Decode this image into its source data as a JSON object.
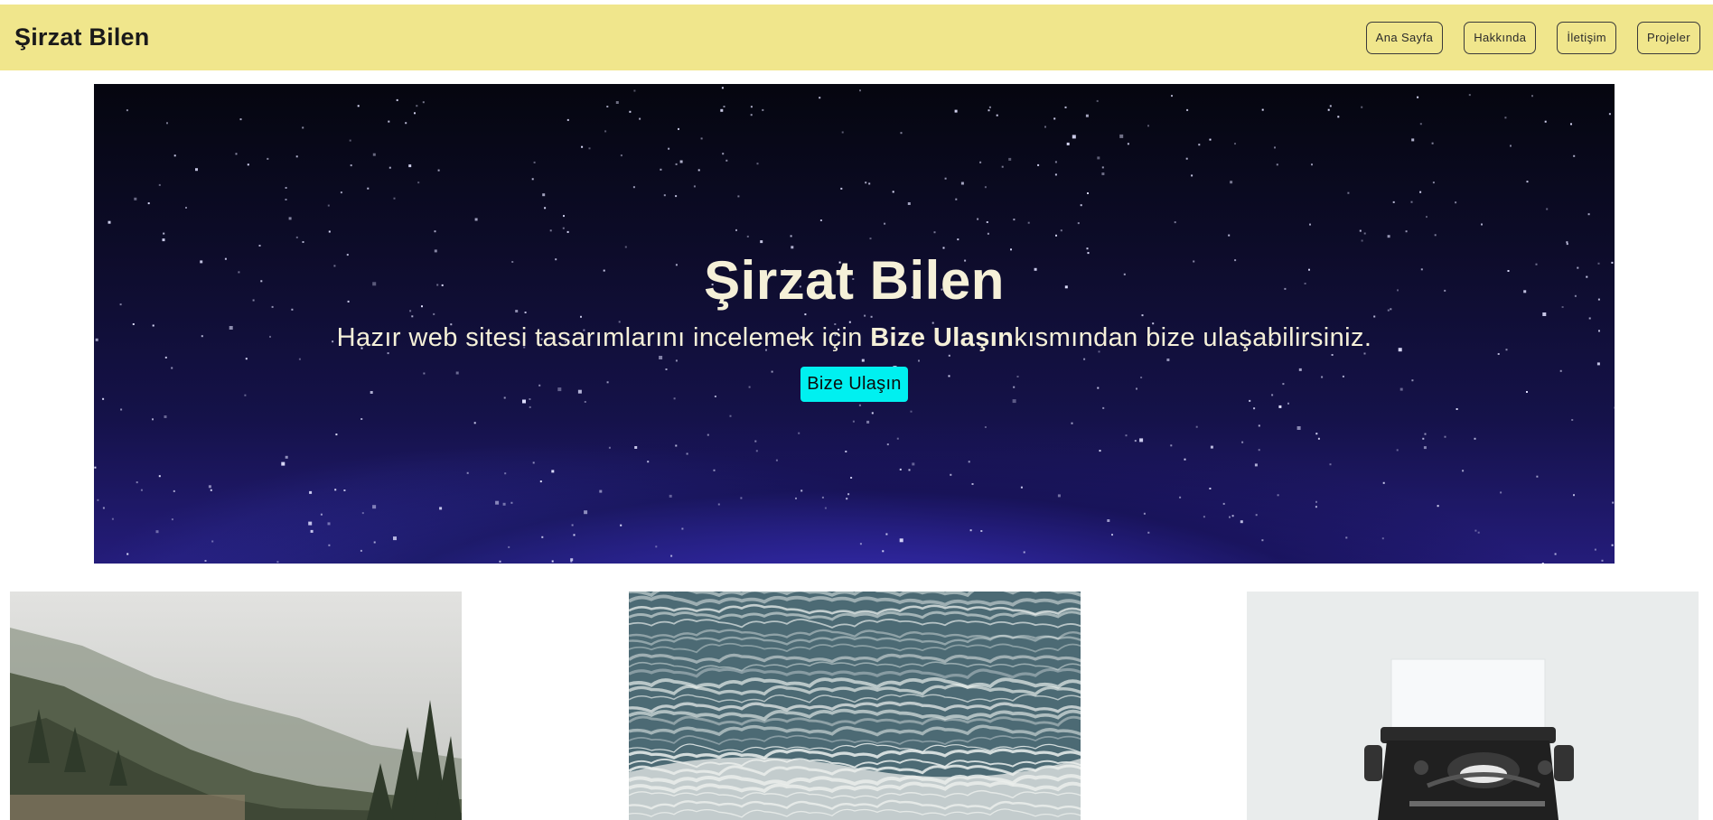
{
  "navbar": {
    "brand": "Şirzat Bilen",
    "links": [
      {
        "label": "Ana Sayfa"
      },
      {
        "label": "Hakkında"
      },
      {
        "label": "İletişim"
      },
      {
        "label": "Projeler"
      }
    ],
    "background_color": "#f0e68c"
  },
  "hero": {
    "title": "Şirzat Bilen",
    "text_before": "Hazır web sitesi tasarımlarını incelemek için ",
    "text_bold": "Bize Ulaşın",
    "text_after": "kısmından bize ulaşabilirsiniz.",
    "cta_label": "Bize Ulaşın",
    "cta_color": "#00f0f0",
    "text_color": "#f5f0d8"
  },
  "gallery": {
    "images": [
      {
        "subject": "misty-forest"
      },
      {
        "subject": "ocean-waves"
      },
      {
        "subject": "typewriter"
      }
    ]
  }
}
